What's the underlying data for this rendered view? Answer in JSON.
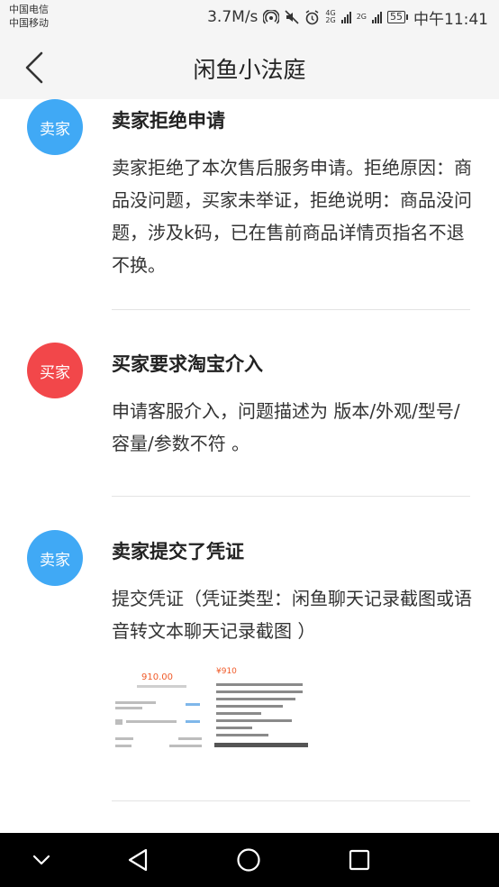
{
  "status_bar": {
    "carrier_1": "中国电信",
    "carrier_2": "中国移动",
    "speed": "3.7M/s",
    "net_label_top": "4G",
    "net_label_bottom": "2G",
    "net2_label": "2G",
    "battery": "55",
    "time": "中午11:41"
  },
  "header": {
    "title": "闲鱼小法庭"
  },
  "timeline": [
    {
      "avatar_label": "卖家",
      "role": "seller",
      "title": "卖家拒绝申请",
      "body": "卖家拒绝了本次售后服务申请。拒绝原因：商品没问题，买家未举证，拒绝说明：商品没问题，涉及k码，已在售前商品详情页指名不退不换。"
    },
    {
      "avatar_label": "买家",
      "role": "buyer",
      "title": "买家要求淘宝介入",
      "body": "申请客服介入，问题描述为 版本/外观/型号/容量/参数不符 。"
    },
    {
      "avatar_label": "卖家",
      "role": "seller",
      "title": "卖家提交了凭证",
      "body": "提交凭证（凭证类型：闲鱼聊天记录截图或语音转文本聊天记录截图 ）"
    }
  ],
  "evidence": {
    "left_price": "910.00",
    "right_price": "¥910"
  },
  "colors": {
    "seller_avatar": "#40a9f5",
    "buyer_avatar": "#f2474a",
    "header_bg": "#f5f5f5",
    "divider": "#e3e3e3"
  },
  "system_nav": {
    "icons": [
      "chevron-down-icon",
      "back-triangle-icon",
      "home-circle-icon",
      "recents-square-icon"
    ]
  }
}
